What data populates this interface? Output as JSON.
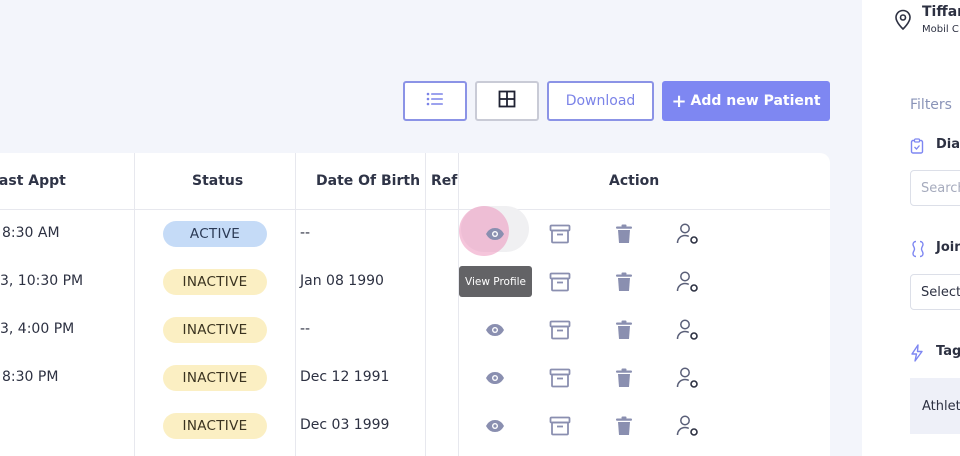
{
  "toolbar": {
    "list_view_icon": "list-icon",
    "grid_view_icon": "grid-icon",
    "download_label": "Download",
    "add_patient_label": "Add new Patient",
    "add_icon": "plus-icon"
  },
  "table": {
    "columns": [
      "Last Appt",
      "Status",
      "Date Of Birth",
      "Ref",
      "Action"
    ],
    "rows": [
      {
        "last_appt": "8:30 AM",
        "status": "ACTIVE",
        "dob": "--"
      },
      {
        "last_appt": "3, 10:30 PM",
        "status": "INACTIVE",
        "dob": "Jan 08 1990"
      },
      {
        "last_appt": "3, 4:00 PM",
        "status": "INACTIVE",
        "dob": "--"
      },
      {
        "last_appt": "8:30 PM",
        "status": "INACTIVE",
        "dob": "Dec 12 1991"
      },
      {
        "last_appt": "",
        "status": "INACTIVE",
        "dob": "Dec 03 1999"
      }
    ],
    "action_icons": [
      "eye-icon",
      "archive-icon",
      "trash-icon",
      "user-settings-icon"
    ],
    "tooltip": "View Profile"
  },
  "side_panel": {
    "user_name": "Tiffany",
    "user_sub": "Mobil C",
    "location_icon": "location-pin-icon",
    "filters_title": "Filters",
    "diagnosis_label": "Diagnosis",
    "diagnosis_placeholder": "Search",
    "joined_label": "Joined",
    "joined_value": "Select",
    "tags_label": "Tags",
    "tag_chip": "Athlete"
  },
  "colors": {
    "accent": "#7e87f2",
    "active_badge": "#c5dbf7",
    "inactive_badge": "#fbefc3",
    "action_icon": "#8a8fb0"
  }
}
